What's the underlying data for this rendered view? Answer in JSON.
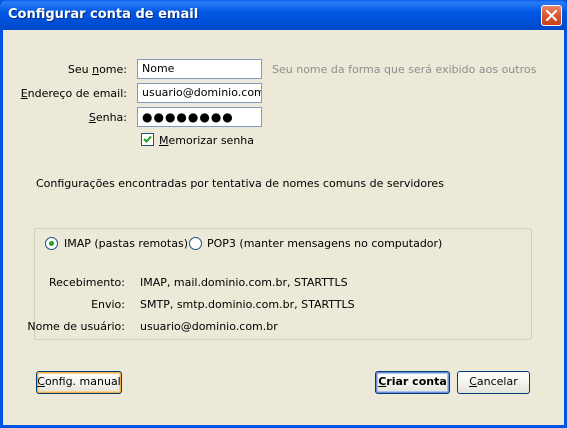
{
  "window": {
    "title": "Configurar conta de email"
  },
  "form": {
    "name": {
      "label_prefix": "Seu ",
      "label_underlined": "n",
      "label_suffix": "ome:",
      "value": "Nome",
      "hint": "Seu nome da forma que será exibido aos outros"
    },
    "email": {
      "label_underlined": "E",
      "label_suffix": "ndereço de email:",
      "value": "usuario@dominio.com.br"
    },
    "password": {
      "label_underlined": "S",
      "label_suffix": "enha:",
      "value": "●●●●●●●●"
    },
    "remember": {
      "label_underlined": "M",
      "label_suffix": "emorizar senha",
      "checked": true
    }
  },
  "status_text": "Configurações encontradas por tentativa de nomes comuns de servidores",
  "protocol": {
    "imap_label": "IMAP (pastas remotas)",
    "pop3_label": "POP3 (manter mensagens no computador)",
    "selected": "IMAP"
  },
  "server_details": {
    "incoming_label": "Recebimento:",
    "incoming_value": "IMAP, mail.dominio.com.br, STARTTLS",
    "outgoing_label": "Envio:",
    "outgoing_value": "SMTP, smtp.dominio.com.br, STARTTLS",
    "username_label": "Nome de usuário:",
    "username_value": "usuario@dominio.com.br"
  },
  "buttons": {
    "manual_underlined": "C",
    "manual_suffix": "onfig. manual",
    "create_underlined": "C",
    "create_suffix": "riar conta",
    "cancel_underlined": "C",
    "cancel_suffix": "ancelar"
  }
}
